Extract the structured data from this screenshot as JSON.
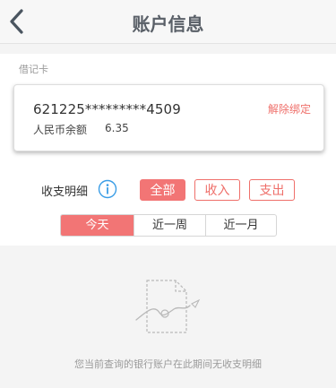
{
  "header": {
    "title": "账户信息"
  },
  "card": {
    "type_label": "借记卡",
    "number": "621225*********4509",
    "unbind_label": "解除绑定",
    "balance_label": "人民币余额",
    "balance_value": "6.35"
  },
  "filter": {
    "label": "收支明细",
    "types": [
      "全部",
      "收入",
      "支出"
    ],
    "selected_type": "全部",
    "periods": [
      "今天",
      "近一周",
      "近一月"
    ],
    "selected_period": "今天"
  },
  "empty": {
    "message": "您当前查询的银行账户在此期间无收支明细"
  },
  "colors": {
    "accent": "#f27575",
    "link": "#ef6f6a",
    "info": "#3a9de6",
    "title": "#5a6068"
  },
  "icons": {
    "back": "chevron-left-icon",
    "info": "info-circle-icon",
    "empty": "empty-document-icon"
  }
}
